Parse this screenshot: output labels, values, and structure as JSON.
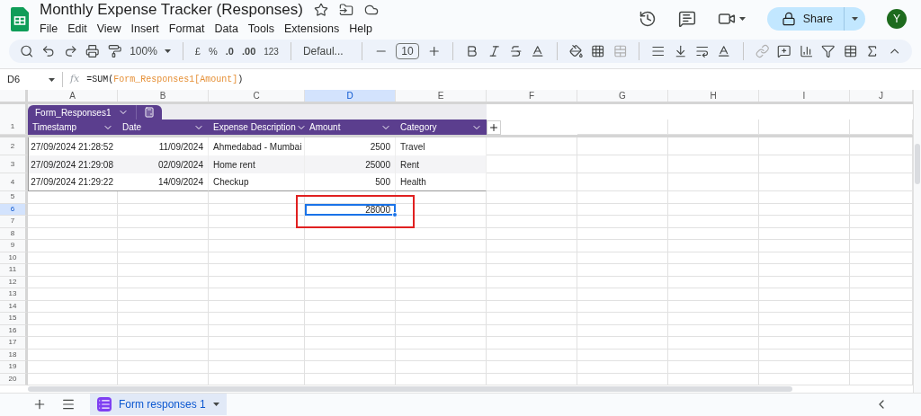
{
  "app": {
    "title": "Monthly Expense Tracker (Responses)",
    "menus": [
      "File",
      "Edit",
      "View",
      "Insert",
      "Format",
      "Data",
      "Tools",
      "Extensions",
      "Help"
    ],
    "share_label": "Share",
    "avatar": "Y"
  },
  "toolbar": {
    "zoom": "100%",
    "currency": "£",
    "percent": "%",
    "decrease_decimals": ".0",
    "increase_decimals": ".00",
    "number_format": "123",
    "font": "Defaul...",
    "font_size": "10"
  },
  "formula_bar": {
    "cell_ref": "D6",
    "function_label": "fx",
    "formula_start": "=SUM(",
    "formula_reference": "Form_Responses1[Amount]",
    "formula_end": ")"
  },
  "grid": {
    "columns": [
      {
        "label": "A",
        "selected": false
      },
      {
        "label": "B",
        "selected": false
      },
      {
        "label": "C",
        "selected": false
      },
      {
        "label": "D",
        "selected": true
      },
      {
        "label": "E",
        "selected": false
      },
      {
        "label": "F",
        "selected": false
      },
      {
        "label": "G",
        "selected": false
      },
      {
        "label": "H",
        "selected": false
      },
      {
        "label": "I",
        "selected": false
      },
      {
        "label": "J",
        "selected": false
      }
    ],
    "rows": [
      {
        "label": "1",
        "selected": false
      },
      {
        "label": "2",
        "selected": false
      },
      {
        "label": "3",
        "selected": false
      },
      {
        "label": "4",
        "selected": false
      },
      {
        "label": "5",
        "selected": false
      },
      {
        "label": "6",
        "selected": true
      },
      {
        "label": "7",
        "selected": false
      },
      {
        "label": "8",
        "selected": false
      },
      {
        "label": "9",
        "selected": false
      },
      {
        "label": "10",
        "selected": false
      },
      {
        "label": "11",
        "selected": false
      },
      {
        "label": "12",
        "selected": false
      },
      {
        "label": "13",
        "selected": false
      },
      {
        "label": "14",
        "selected": false
      },
      {
        "label": "15",
        "selected": false
      },
      {
        "label": "16",
        "selected": false
      },
      {
        "label": "17",
        "selected": false
      },
      {
        "label": "18",
        "selected": false
      },
      {
        "label": "19",
        "selected": false
      },
      {
        "label": "20",
        "selected": false
      }
    ]
  },
  "table": {
    "name": "Form_Responses1",
    "columns": [
      "Timestamp",
      "Date",
      "Expense Description",
      "Amount",
      "Category"
    ],
    "rows": [
      [
        "27/09/2024 21:28:52",
        "11/09/2024",
        "Ahmedabad - Mumbai",
        "2500",
        "Travel"
      ],
      [
        "27/09/2024 21:29:08",
        "02/09/2024",
        "Home rent",
        "25000",
        "Rent"
      ],
      [
        "27/09/2024 21:29:22",
        "14/09/2024",
        "Checkup",
        "500",
        "Health"
      ]
    ]
  },
  "active_cell": {
    "value": "28000"
  },
  "sheet_tabs": [
    {
      "label": "Form responses 1",
      "selected": true
    }
  ]
}
